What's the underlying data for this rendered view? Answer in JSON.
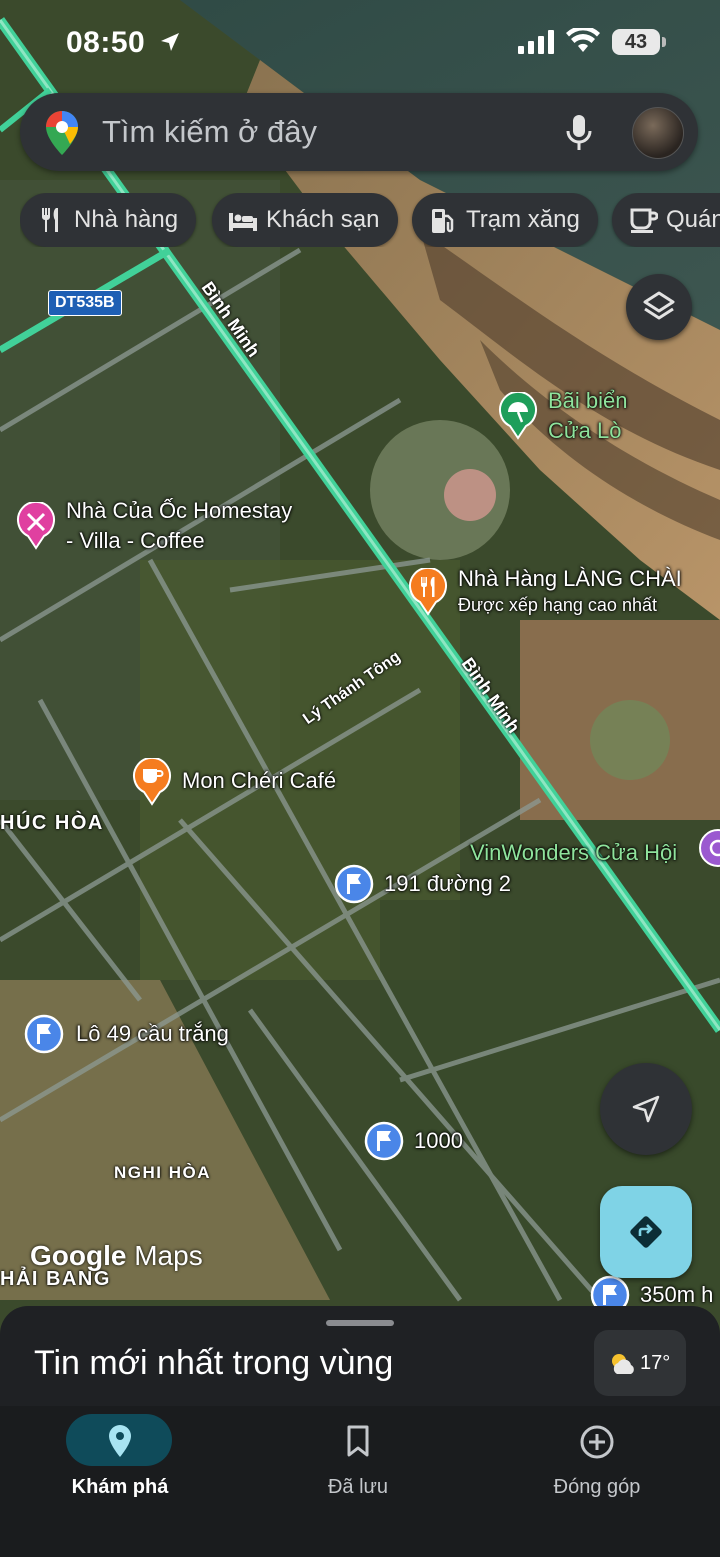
{
  "status_bar": {
    "time": "08:50",
    "battery": "43"
  },
  "search": {
    "placeholder": "Tìm kiếm ở đây"
  },
  "chips": [
    {
      "label": "Nhà hàng",
      "icon": "fork-knife-icon"
    },
    {
      "label": "Khách sạn",
      "icon": "bed-icon"
    },
    {
      "label": "Trạm xăng",
      "icon": "gas-station-icon"
    },
    {
      "label": "Quán",
      "icon": "coffee-cup-icon"
    }
  ],
  "map": {
    "road_labels": {
      "binh_minh_1": "Bình Minh",
      "binh_minh_2": "Bình Minh",
      "ly_thanh_tong": "Lý Thánh Tông",
      "route": "DT535B"
    },
    "area_labels": {
      "phuc_hoa": "HÚC HÒA",
      "nghi_hoa": "NGHI HÒA",
      "hai_bang": "HẢI BANG"
    },
    "pois": {
      "beach": {
        "line1": "Bãi biển",
        "line2": "Cửa Lò",
        "icon": "beach-umbrella-icon"
      },
      "homestay": {
        "line1": "Nhà Của Ốc Homestay",
        "line2": "- Villa - Coffee",
        "icon": "fork-knife-icon"
      },
      "restaurant": {
        "name": "Nhà Hàng LÀNG CHÀI",
        "sub": "Được xếp hạng cao nhất",
        "icon": "fork-knife-icon"
      },
      "cafe": {
        "name": "Mon Chéri Café",
        "icon": "coffee-cup-icon"
      },
      "vinwonders": {
        "name": "VinWonders Cửa Hội"
      },
      "p191": {
        "name": "191 đường 2"
      },
      "lo49": {
        "name": "Lô 49 cầu trắng"
      },
      "p1000": {
        "name": "1000"
      },
      "p350": {
        "name": "350m h"
      }
    },
    "attribution": {
      "google": "Google",
      "maps": "Maps"
    }
  },
  "sheet": {
    "title": "Tin mới nhất trong vùng",
    "temperature": "17°"
  },
  "nav": [
    {
      "label": "Khám phá",
      "icon": "location-pin-icon",
      "active": true
    },
    {
      "label": "Đã lưu",
      "icon": "bookmark-icon",
      "active": false
    },
    {
      "label": "Đóng góp",
      "icon": "plus-circle-icon",
      "active": false
    }
  ],
  "colors": {
    "accent": "#7fd3e6",
    "nav_active_pill": "#0f4b5a",
    "poi_orange": "#f57c1f",
    "poi_blue": "#4a86e8",
    "poi_pink": "#e040a0",
    "poi_green": "#1e9e5a",
    "road_highlight": "#41d199"
  }
}
